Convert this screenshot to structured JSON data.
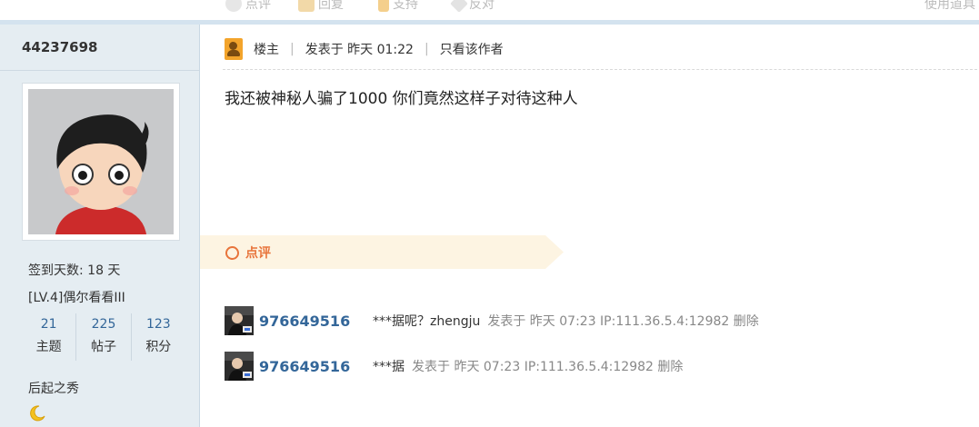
{
  "topbar": {
    "actions": [
      "点评",
      "回复",
      "支持",
      "反对"
    ],
    "right_text": "使用道具"
  },
  "sidebar": {
    "username": "44237698",
    "checkin": "签到天数: 18 天",
    "level": "[LV.4]偶尔看看III",
    "stats": [
      {
        "num": "21",
        "label": "主题"
      },
      {
        "num": "225",
        "label": "帖子"
      },
      {
        "num": "123",
        "label": "积分"
      }
    ],
    "title": "后起之秀"
  },
  "post": {
    "role": "楼主",
    "posted": "发表于 昨天 01:22",
    "author_only": "只看该作者",
    "content": "我还被神秘人骗了1000  你们竟然这样子对待这种人"
  },
  "review": {
    "title": "点评",
    "comments": [
      {
        "user": "976649516",
        "text": "***据呢？zhengju",
        "meta": "发表于 昨天 07:23 IP:111.36.5.4:12982 删除"
      },
      {
        "user": "976649516",
        "text": "***据",
        "meta": "发表于 昨天 07:23 IP:111.36.5.4:12982 删除"
      }
    ]
  }
}
